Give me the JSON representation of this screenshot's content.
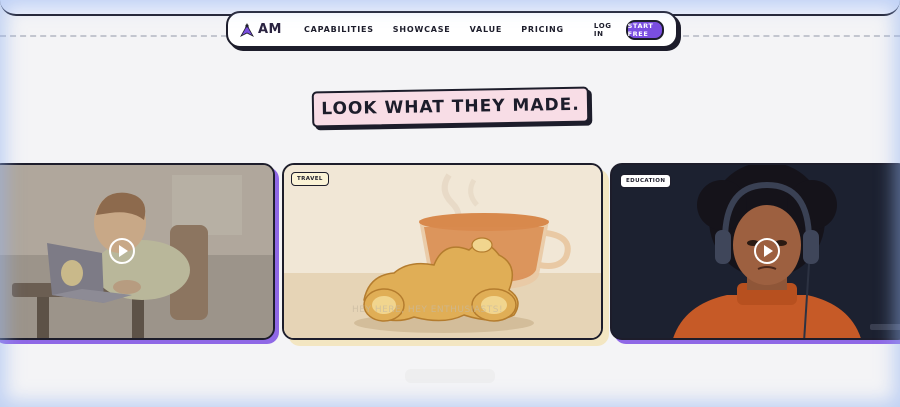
{
  "nav": {
    "logo_text": "AM",
    "links": [
      "CAPABILITIES",
      "SHOWCASE",
      "VALUE",
      "PRICING"
    ],
    "login": "LOG IN",
    "cta": "START FREE"
  },
  "showcase": {
    "headline": "LOOK WHAT THEY MADE.",
    "cards": [
      {
        "tag": "",
        "play_icon": "play-icon"
      },
      {
        "tag": "TRAVEL",
        "subtitle": "HEY HERE, HEY ENTHUSIASTS!",
        "play_icon": ""
      },
      {
        "tag": "EDUCATION",
        "play_icon": "play-icon"
      }
    ]
  },
  "colors": {
    "accent": "#7a4ee0",
    "ink": "#1d1d2b",
    "headline_bg": "#f8dde6",
    "tag_bg": "#fbf3d6",
    "card_shadow": "#8f68e6"
  }
}
